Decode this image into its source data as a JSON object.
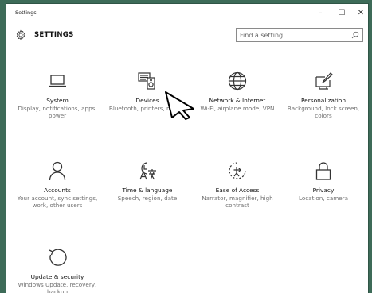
{
  "window": {
    "title": "Settings",
    "controls": {
      "minimize": "–",
      "maximize": "☐",
      "close": "✕"
    }
  },
  "header": {
    "title": "SETTINGS",
    "search_placeholder": "Find a setting"
  },
  "tiles": [
    {
      "name": "System",
      "description": "Display, notifications, apps, power",
      "icon": "laptop-icon"
    },
    {
      "name": "Devices",
      "description": "Bluetooth, printers, mouse",
      "icon": "devices-icon"
    },
    {
      "name": "Network & Internet",
      "description": "Wi-Fi, airplane mode, VPN",
      "icon": "globe-icon"
    },
    {
      "name": "Personalization",
      "description": "Background, lock screen, colors",
      "icon": "paint-icon"
    },
    {
      "name": "Accounts",
      "description": "Your account, sync settings, work, other users",
      "icon": "person-icon"
    },
    {
      "name": "Time & language",
      "description": "Speech, region, date",
      "icon": "time-language-icon"
    },
    {
      "name": "Ease of Access",
      "description": "Narrator, magnifier, high contrast",
      "icon": "ease-of-access-icon"
    },
    {
      "name": "Privacy",
      "description": "Location, camera",
      "icon": "lock-icon"
    },
    {
      "name": "Update & security",
      "description": "Windows Update, recovery, backup",
      "icon": "update-icon"
    }
  ],
  "colors": {
    "desktop": "#3d6b58",
    "window_bg": "#ffffff",
    "icon": "#333333",
    "description": "#707070"
  }
}
